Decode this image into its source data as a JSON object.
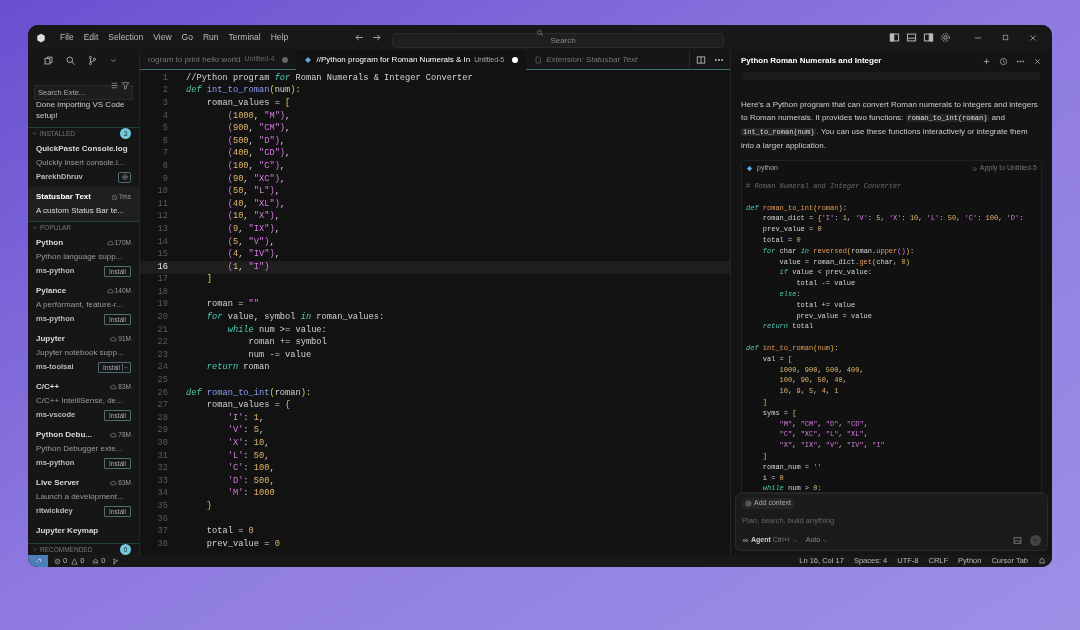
{
  "title_bar": {
    "menu": [
      "File",
      "Edit",
      "Selection",
      "View",
      "Go",
      "Run",
      "Terminal",
      "Help"
    ],
    "search": {
      "placeholder": "Search"
    }
  },
  "sidebar": {
    "search": {
      "placeholder": "Search Exte..."
    },
    "notice": "Done importing VS Code setup!",
    "sections": [
      {
        "title": "INSTALLED",
        "count": "3",
        "expanded": true,
        "items": [
          {
            "name": "QuickPaste Console.log",
            "description": "Quickly insert console.l...",
            "publisher": "ParekhDhruv",
            "kind": "gear",
            "selected": false
          },
          {
            "name": "Statusbar Text",
            "stat": {
              "kind": "time",
              "text": "7ms"
            },
            "description": "A custom Status Bar te...",
            "kind": "none",
            "selected": true
          }
        ]
      },
      {
        "title": "POPULAR",
        "expanded": true,
        "items": [
          {
            "name": "Python",
            "stat": {
              "kind": "downloads",
              "text": "170M"
            },
            "description": "Python language supp...",
            "publisher": "ms-python",
            "action": "Install",
            "kind": "install",
            "selected": false
          },
          {
            "name": "Pylance",
            "stat": {
              "kind": "downloads",
              "text": "140M"
            },
            "description": "A performant, feature-r...",
            "publisher": "ms-python",
            "action": "Install",
            "kind": "install",
            "selected": false
          },
          {
            "name": "Jupyter",
            "stat": {
              "kind": "downloads",
              "text": "91M"
            },
            "description": "Jupyter notebook supp...",
            "publisher": "ms-toolsai",
            "action": "Install",
            "kind": "split",
            "selected": false
          },
          {
            "name": "C/C++",
            "stat": {
              "kind": "downloads",
              "text": "83M"
            },
            "description": "C/C++ IntelliSense, de...",
            "publisher": "ms-vscode",
            "action": "Install",
            "kind": "install",
            "selected": false
          },
          {
            "name": "Python Debu...",
            "stat": {
              "kind": "downloads",
              "text": "78M"
            },
            "description": "Python Debugger exte...",
            "publisher": "ms-python",
            "action": "Install",
            "kind": "install",
            "selected": false
          },
          {
            "name": "Live Server",
            "stat": {
              "kind": "downloads",
              "text": "63M"
            },
            "description": "Launch a development...",
            "publisher": "ritwickdey",
            "action": "Install",
            "kind": "install",
            "selected": false
          },
          {
            "name": "Jupyter Keymap",
            "kind": "none",
            "selected": false
          }
        ]
      },
      {
        "title": "RECOMMENDED",
        "count": "0",
        "expanded": false
      }
    ]
  },
  "editor": {
    "tabs": [
      {
        "label": "rogram to print hello world",
        "description": "Untitled-4",
        "kind": "file",
        "selected": false,
        "modified": true
      },
      {
        "label": "//Python program for Roman Numerals & In",
        "description": "Untitled-5",
        "kind": "python",
        "selected": true,
        "modified": true
      },
      {
        "label": "Extension: Statusbar Text",
        "kind": "extension",
        "selected": false,
        "modified": false
      }
    ],
    "lines": [
      {
        "number": "1",
        "current": false,
        "tokens": [
          {
            "kind": "plain",
            "text": "//Python program "
          },
          {
            "kind": "kw",
            "text": "for"
          },
          {
            "kind": "plain",
            "text": " Roman Numerals & Integer Converter"
          }
        ]
      },
      {
        "number": "2",
        "current": false,
        "tokens": [
          {
            "kind": "kw",
            "text": "def "
          },
          {
            "kind": "fn",
            "text": "int_to_roman"
          },
          {
            "kind": "br",
            "text": "("
          },
          {
            "kind": "plain",
            "text": "num"
          },
          {
            "kind": "br",
            "text": ")"
          },
          {
            "kind": "plain",
            "text": ":"
          }
        ]
      },
      {
        "number": "3",
        "current": false,
        "tokens": [
          {
            "kind": "plain",
            "text": "    roman_values = "
          },
          {
            "kind": "br",
            "text": "["
          }
        ]
      },
      {
        "number": "4",
        "current": false,
        "tokens": [
          {
            "kind": "pr",
            "text": "        ("
          },
          {
            "kind": "num",
            "text": "1000"
          },
          {
            "kind": "plain",
            "text": ", "
          },
          {
            "kind": "str",
            "text": "\"M\""
          },
          {
            "kind": "pr",
            "text": ")"
          },
          {
            "kind": "plain",
            "text": ","
          }
        ]
      },
      {
        "number": "5",
        "current": false,
        "tokens": [
          {
            "kind": "pr",
            "text": "        ("
          },
          {
            "kind": "num",
            "text": "900"
          },
          {
            "kind": "plain",
            "text": ", "
          },
          {
            "kind": "str",
            "text": "\"CM\""
          },
          {
            "kind": "pr",
            "text": ")"
          },
          {
            "kind": "plain",
            "text": ","
          }
        ]
      },
      {
        "number": "6",
        "current": false,
        "tokens": [
          {
            "kind": "pr",
            "text": "        ("
          },
          {
            "kind": "num",
            "text": "500"
          },
          {
            "kind": "plain",
            "text": ", "
          },
          {
            "kind": "str",
            "text": "\"D\""
          },
          {
            "kind": "pr",
            "text": ")"
          },
          {
            "kind": "plain",
            "text": ","
          }
        ]
      },
      {
        "number": "7",
        "current": false,
        "tokens": [
          {
            "kind": "pr",
            "text": "        ("
          },
          {
            "kind": "num",
            "text": "400"
          },
          {
            "kind": "plain",
            "text": ", "
          },
          {
            "kind": "str",
            "text": "\"CD\""
          },
          {
            "kind": "pr",
            "text": ")"
          },
          {
            "kind": "plain",
            "text": ","
          }
        ]
      },
      {
        "number": "8",
        "current": false,
        "tokens": [
          {
            "kind": "pr",
            "text": "        ("
          },
          {
            "kind": "num",
            "text": "100"
          },
          {
            "kind": "plain",
            "text": ", "
          },
          {
            "kind": "str",
            "text": "\"C\""
          },
          {
            "kind": "pr",
            "text": ")"
          },
          {
            "kind": "plain",
            "text": ","
          }
        ]
      },
      {
        "number": "9",
        "current": false,
        "tokens": [
          {
            "kind": "pr",
            "text": "        ("
          },
          {
            "kind": "num",
            "text": "90"
          },
          {
            "kind": "plain",
            "text": ", "
          },
          {
            "kind": "str",
            "text": "\"XC\""
          },
          {
            "kind": "pr",
            "text": ")"
          },
          {
            "kind": "plain",
            "text": ","
          }
        ]
      },
      {
        "number": "10",
        "current": false,
        "tokens": [
          {
            "kind": "pr",
            "text": "        ("
          },
          {
            "kind": "num",
            "text": "50"
          },
          {
            "kind": "plain",
            "text": ", "
          },
          {
            "kind": "str",
            "text": "\"L\""
          },
          {
            "kind": "pr",
            "text": ")"
          },
          {
            "kind": "plain",
            "text": ","
          }
        ]
      },
      {
        "number": "11",
        "current": false,
        "tokens": [
          {
            "kind": "pr",
            "text": "        ("
          },
          {
            "kind": "num",
            "text": "40"
          },
          {
            "kind": "plain",
            "text": ", "
          },
          {
            "kind": "str",
            "text": "\"XL\""
          },
          {
            "kind": "pr",
            "text": ")"
          },
          {
            "kind": "plain",
            "text": ","
          }
        ]
      },
      {
        "number": "12",
        "current": false,
        "tokens": [
          {
            "kind": "pr",
            "text": "        ("
          },
          {
            "kind": "num",
            "text": "10"
          },
          {
            "kind": "plain",
            "text": ", "
          },
          {
            "kind": "str",
            "text": "\"X\""
          },
          {
            "kind": "pr",
            "text": ")"
          },
          {
            "kind": "plain",
            "text": ","
          }
        ]
      },
      {
        "number": "13",
        "current": false,
        "tokens": [
          {
            "kind": "pr",
            "text": "        ("
          },
          {
            "kind": "num",
            "text": "9"
          },
          {
            "kind": "plain",
            "text": ", "
          },
          {
            "kind": "str",
            "text": "\"IX\""
          },
          {
            "kind": "pr",
            "text": ")"
          },
          {
            "kind": "plain",
            "text": ","
          }
        ]
      },
      {
        "number": "14",
        "current": false,
        "tokens": [
          {
            "kind": "pr",
            "text": "        ("
          },
          {
            "kind": "num",
            "text": "5"
          },
          {
            "kind": "plain",
            "text": ", "
          },
          {
            "kind": "str",
            "text": "\"V\""
          },
          {
            "kind": "pr",
            "text": ")"
          },
          {
            "kind": "plain",
            "text": ","
          }
        ]
      },
      {
        "number": "15",
        "current": false,
        "tokens": [
          {
            "kind": "pr",
            "text": "        ("
          },
          {
            "kind": "num",
            "text": "4"
          },
          {
            "kind": "plain",
            "text": ", "
          },
          {
            "kind": "str",
            "text": "\"IV\""
          },
          {
            "kind": "pr",
            "text": ")"
          },
          {
            "kind": "plain",
            "text": ","
          }
        ]
      },
      {
        "number": "16",
        "current": true,
        "tokens": [
          {
            "kind": "pr",
            "text": "        ("
          },
          {
            "kind": "num",
            "text": "1"
          },
          {
            "kind": "plain",
            "text": ", "
          },
          {
            "kind": "str",
            "text": "\"I\""
          },
          {
            "kind": "pr",
            "text": ")"
          }
        ]
      },
      {
        "number": "17",
        "current": false,
        "tokens": [
          {
            "kind": "br",
            "text": "    ]"
          }
        ]
      },
      {
        "number": "18",
        "current": false
      },
      {
        "number": "19",
        "current": false,
        "tokens": [
          {
            "kind": "plain",
            "text": "    roman = "
          },
          {
            "kind": "str",
            "text": "\"\""
          }
        ]
      },
      {
        "number": "20",
        "current": false,
        "tokens": [
          {
            "kind": "kw",
            "text": "    for"
          },
          {
            "kind": "plain",
            "text": " value, symbol "
          },
          {
            "kind": "kw",
            "text": "in"
          },
          {
            "kind": "plain",
            "text": " roman_values:"
          }
        ]
      },
      {
        "number": "21",
        "current": false,
        "tokens": [
          {
            "kind": "kw",
            "text": "        while"
          },
          {
            "kind": "plain",
            "text": " num >= value:"
          }
        ]
      },
      {
        "number": "22",
        "current": false,
        "tokens": [
          {
            "kind": "plain",
            "text": "            roman += symbol"
          }
        ]
      },
      {
        "number": "23",
        "current": false,
        "tokens": [
          {
            "kind": "plain",
            "text": "            num -= value"
          }
        ]
      },
      {
        "number": "24",
        "current": false,
        "tokens": [
          {
            "kind": "kw",
            "text": "    return"
          },
          {
            "kind": "plain",
            "text": " roman"
          }
        ]
      },
      {
        "number": "25",
        "current": false
      },
      {
        "number": "26",
        "current": false,
        "tokens": [
          {
            "kind": "kw",
            "text": "def "
          },
          {
            "kind": "fn",
            "text": "roman_to_int"
          },
          {
            "kind": "br",
            "text": "("
          },
          {
            "kind": "plain",
            "text": "roman"
          },
          {
            "kind": "br",
            "text": ")"
          },
          {
            "kind": "plain",
            "text": ":"
          }
        ]
      },
      {
        "number": "27",
        "current": false,
        "tokens": [
          {
            "kind": "plain",
            "text": "    roman_values = "
          },
          {
            "kind": "br",
            "text": "{"
          }
        ]
      },
      {
        "number": "28",
        "current": false,
        "tokens": [
          {
            "kind": "str",
            "text": "        'I'"
          },
          {
            "kind": "plain",
            "text": ": "
          },
          {
            "kind": "num",
            "text": "1"
          },
          {
            "kind": "plain",
            "text": ","
          }
        ]
      },
      {
        "number": "29",
        "current": false,
        "tokens": [
          {
            "kind": "str",
            "text": "        'V'"
          },
          {
            "kind": "plain",
            "text": ": "
          },
          {
            "kind": "num",
            "text": "5"
          },
          {
            "kind": "plain",
            "text": ","
          }
        ]
      },
      {
        "number": "30",
        "current": false,
        "tokens": [
          {
            "kind": "str",
            "text": "        'X'"
          },
          {
            "kind": "plain",
            "text": ": "
          },
          {
            "kind": "num",
            "text": "10"
          },
          {
            "kind": "plain",
            "text": ","
          }
        ]
      },
      {
        "number": "31",
        "current": false,
        "tokens": [
          {
            "kind": "str",
            "text": "        'L'"
          },
          {
            "kind": "plain",
            "text": ": "
          },
          {
            "kind": "num",
            "text": "50"
          },
          {
            "kind": "plain",
            "text": ","
          }
        ]
      },
      {
        "number": "32",
        "current": false,
        "tokens": [
          {
            "kind": "str",
            "text": "        'C'"
          },
          {
            "kind": "plain",
            "text": ": "
          },
          {
            "kind": "num",
            "text": "100"
          },
          {
            "kind": "plain",
            "text": ","
          }
        ]
      },
      {
        "number": "33",
        "current": false,
        "tokens": [
          {
            "kind": "str",
            "text": "        'D'"
          },
          {
            "kind": "plain",
            "text": ": "
          },
          {
            "kind": "num",
            "text": "500"
          },
          {
            "kind": "plain",
            "text": ","
          }
        ]
      },
      {
        "number": "34",
        "current": false,
        "tokens": [
          {
            "kind": "str",
            "text": "        'M'"
          },
          {
            "kind": "plain",
            "text": ": "
          },
          {
            "kind": "num",
            "text": "1000"
          }
        ]
      },
      {
        "number": "35",
        "current": false,
        "tokens": [
          {
            "kind": "br",
            "text": "    }"
          }
        ]
      },
      {
        "number": "36",
        "current": false
      },
      {
        "number": "37",
        "current": false,
        "tokens": [
          {
            "kind": "plain",
            "text": "    total = "
          },
          {
            "kind": "num",
            "text": "0"
          }
        ]
      },
      {
        "number": "38",
        "current": false,
        "tokens": [
          {
            "kind": "plain",
            "text": "    prev_value = "
          },
          {
            "kind": "num",
            "text": "0"
          }
        ]
      }
    ]
  },
  "chat": {
    "title": "Python Roman Numerals and Integer",
    "response": [
      {
        "kind": "text",
        "text": "Here's a Python program that can convert Roman numerals to integers and integers to Roman numerals. It provides two functions: "
      },
      {
        "kind": "code",
        "text": "roman_to_int(roman)"
      },
      {
        "kind": "text",
        "text": " and "
      },
      {
        "kind": "code",
        "text": "int_to_roman(num)"
      },
      {
        "kind": "text",
        "text": ". You can use these functions interactively or integrate them into a larger application."
      }
    ],
    "code_block": {
      "language": "python",
      "action": "Apply to Untitled-5",
      "lines": [
        {
          "kind": "code",
          "tokens": [
            {
              "kind": "cm",
              "text": "# Roman Numeral and Integer Converter"
            }
          ]
        },
        {
          "kind": "blank"
        },
        {
          "kind": "code",
          "tokens": [
            {
              "kind": "kw",
              "text": "def "
            },
            {
              "kind": "fn",
              "text": "roman_to_int"
            },
            {
              "kind": "br",
              "text": "("
            },
            {
              "kind": "fn",
              "text": "roman"
            },
            {
              "kind": "br",
              "text": ")"
            },
            {
              "kind": "plain",
              "text": ":"
            }
          ]
        },
        {
          "kind": "code",
          "tokens": [
            {
              "kind": "plain",
              "text": "    roman_dict = "
            },
            {
              "kind": "br",
              "text": "{"
            },
            {
              "kind": "str",
              "text": "'I'"
            },
            {
              "kind": "plain",
              "text": ": "
            },
            {
              "kind": "num",
              "text": "1"
            },
            {
              "kind": "plain",
              "text": ", "
            },
            {
              "kind": "str",
              "text": "'V'"
            },
            {
              "kind": "plain",
              "text": ": "
            },
            {
              "kind": "num",
              "text": "5"
            },
            {
              "kind": "plain",
              "text": ", "
            },
            {
              "kind": "str",
              "text": "'X'"
            },
            {
              "kind": "plain",
              "text": ": "
            },
            {
              "kind": "num",
              "text": "10"
            },
            {
              "kind": "plain",
              "text": ", "
            },
            {
              "kind": "str",
              "text": "'L'"
            },
            {
              "kind": "plain",
              "text": ": "
            },
            {
              "kind": "num",
              "text": "50"
            },
            {
              "kind": "plain",
              "text": ", "
            },
            {
              "kind": "str",
              "text": "'C'"
            },
            {
              "kind": "plain",
              "text": ": "
            },
            {
              "kind": "num",
              "text": "100"
            },
            {
              "kind": "plain",
              "text": ", "
            },
            {
              "kind": "str",
              "text": "'D'"
            },
            {
              "kind": "plain",
              "text": ":"
            }
          ]
        },
        {
          "kind": "code",
          "tokens": [
            {
              "kind": "plain",
              "text": "    prev_value = "
            },
            {
              "kind": "num",
              "text": "0"
            }
          ]
        },
        {
          "kind": "code",
          "tokens": [
            {
              "kind": "plain",
              "text": "    total = "
            },
            {
              "kind": "num",
              "text": "0"
            }
          ]
        },
        {
          "kind": "code",
          "tokens": [
            {
              "kind": "kw",
              "text": "    for"
            },
            {
              "kind": "plain",
              "text": " char "
            },
            {
              "kind": "kw",
              "text": "in "
            },
            {
              "kind": "fn",
              "text": "reversed"
            },
            {
              "kind": "br",
              "text": "("
            },
            {
              "kind": "plain",
              "text": "roman."
            },
            {
              "kind": "fn",
              "text": "upper"
            },
            {
              "kind": "pr",
              "text": "()"
            },
            {
              "kind": "br",
              "text": ")"
            },
            {
              "kind": "plain",
              "text": ":"
            }
          ]
        },
        {
          "kind": "code",
          "tokens": [
            {
              "kind": "plain",
              "text": "        value = roman_dict."
            },
            {
              "kind": "fn",
              "text": "get"
            },
            {
              "kind": "br",
              "text": "("
            },
            {
              "kind": "plain",
              "text": "char, "
            },
            {
              "kind": "num",
              "text": "0"
            },
            {
              "kind": "br",
              "text": ")"
            }
          ]
        },
        {
          "kind": "code",
          "tokens": [
            {
              "kind": "kw",
              "text": "        if"
            },
            {
              "kind": "plain",
              "text": " value < prev_value:"
            }
          ]
        },
        {
          "kind": "code",
          "tokens": [
            {
              "kind": "plain",
              "text": "            total -= value"
            }
          ]
        },
        {
          "kind": "code",
          "tokens": [
            {
              "kind": "kw",
              "text": "        else"
            },
            {
              "kind": "plain",
              "text": ":"
            }
          ]
        },
        {
          "kind": "code",
          "tokens": [
            {
              "kind": "plain",
              "text": "            total += value"
            }
          ]
        },
        {
          "kind": "code",
          "tokens": [
            {
              "kind": "plain",
              "text": "            prev_value = value"
            }
          ]
        },
        {
          "kind": "code",
          "tokens": [
            {
              "kind": "kw",
              "text": "    return"
            },
            {
              "kind": "plain",
              "text": " total"
            }
          ]
        },
        {
          "kind": "blank"
        },
        {
          "kind": "code",
          "tokens": [
            {
              "kind": "kw",
              "text": "def "
            },
            {
              "kind": "fn",
              "text": "int_to_roman"
            },
            {
              "kind": "br",
              "text": "("
            },
            {
              "kind": "fn",
              "text": "num"
            },
            {
              "kind": "br",
              "text": ")"
            },
            {
              "kind": "plain",
              "text": ":"
            }
          ]
        },
        {
          "kind": "code",
          "tokens": [
            {
              "kind": "plain",
              "text": "    val = "
            },
            {
              "kind": "br",
              "text": "["
            }
          ]
        },
        {
          "kind": "code",
          "tokens": [
            {
              "kind": "num",
              "text": "        1000"
            },
            {
              "kind": "plain",
              "text": ", "
            },
            {
              "kind": "num",
              "text": "900"
            },
            {
              "kind": "plain",
              "text": ", "
            },
            {
              "kind": "num",
              "text": "500"
            },
            {
              "kind": "plain",
              "text": ", "
            },
            {
              "kind": "num",
              "text": "400"
            },
            {
              "kind": "plain",
              "text": ","
            }
          ]
        },
        {
          "kind": "code",
          "tokens": [
            {
              "kind": "num",
              "text": "        100"
            },
            {
              "kind": "plain",
              "text": ", "
            },
            {
              "kind": "num",
              "text": "90"
            },
            {
              "kind": "plain",
              "text": ", "
            },
            {
              "kind": "num",
              "text": "50"
            },
            {
              "kind": "plain",
              "text": ", "
            },
            {
              "kind": "num",
              "text": "40"
            },
            {
              "kind": "plain",
              "text": ","
            }
          ]
        },
        {
          "kind": "code",
          "tokens": [
            {
              "kind": "num",
              "text": "        10"
            },
            {
              "kind": "plain",
              "text": ", "
            },
            {
              "kind": "num",
              "text": "9"
            },
            {
              "kind": "plain",
              "text": ", "
            },
            {
              "kind": "num",
              "text": "5"
            },
            {
              "kind": "plain",
              "text": ", "
            },
            {
              "kind": "num",
              "text": "4"
            },
            {
              "kind": "plain",
              "text": ", "
            },
            {
              "kind": "num",
              "text": "1"
            }
          ]
        },
        {
          "kind": "code",
          "tokens": [
            {
              "kind": "br",
              "text": "    ]"
            }
          ]
        },
        {
          "kind": "code",
          "tokens": [
            {
              "kind": "plain",
              "text": "    syms = "
            },
            {
              "kind": "br",
              "text": "["
            }
          ]
        },
        {
          "kind": "code",
          "tokens": [
            {
              "kind": "str",
              "text": "        \"M\""
            },
            {
              "kind": "plain",
              "text": ", "
            },
            {
              "kind": "str",
              "text": "\"CM\""
            },
            {
              "kind": "plain",
              "text": ", "
            },
            {
              "kind": "str",
              "text": "\"D\""
            },
            {
              "kind": "plain",
              "text": ", "
            },
            {
              "kind": "str",
              "text": "\"CD\""
            },
            {
              "kind": "plain",
              "text": ","
            }
          ]
        },
        {
          "kind": "code",
          "tokens": [
            {
              "kind": "str",
              "text": "        \"C\""
            },
            {
              "kind": "plain",
              "text": ", "
            },
            {
              "kind": "str",
              "text": "\"XC\""
            },
            {
              "kind": "plain",
              "text": ", "
            },
            {
              "kind": "str",
              "text": "\"L\""
            },
            {
              "kind": "plain",
              "text": ", "
            },
            {
              "kind": "str",
              "text": "\"XL\""
            },
            {
              "kind": "plain",
              "text": ","
            }
          ]
        },
        {
          "kind": "code",
          "tokens": [
            {
              "kind": "str",
              "text": "        \"X\""
            },
            {
              "kind": "plain",
              "text": ", "
            },
            {
              "kind": "str",
              "text": "\"IX\""
            },
            {
              "kind": "plain",
              "text": ", "
            },
            {
              "kind": "str",
              "text": "\"V\""
            },
            {
              "kind": "plain",
              "text": ", "
            },
            {
              "kind": "str",
              "text": "\"IV\""
            },
            {
              "kind": "plain",
              "text": ", "
            },
            {
              "kind": "str",
              "text": "\"I\""
            }
          ]
        },
        {
          "kind": "code",
          "tokens": [
            {
              "kind": "br",
              "text": "    ]"
            }
          ]
        },
        {
          "kind": "code",
          "tokens": [
            {
              "kind": "plain",
              "text": "    roman_num = "
            },
            {
              "kind": "str",
              "text": "''"
            }
          ]
        },
        {
          "kind": "code",
          "tokens": [
            {
              "kind": "plain",
              "text": "    i = "
            },
            {
              "kind": "num",
              "text": "0"
            }
          ]
        },
        {
          "kind": "code",
          "tokens": [
            {
              "kind": "kw",
              "text": "    while"
            },
            {
              "kind": "plain",
              "text": " num > "
            },
            {
              "kind": "num",
              "text": "0"
            },
            {
              "kind": "plain",
              "text": ":"
            }
          ]
        }
      ]
    },
    "composer": {
      "context_button": "Add context",
      "placeholder": "Plan, search, build anything",
      "mode": "Agent",
      "shortcut": "Ctrl+I",
      "model": "Auto"
    }
  },
  "status_bar": {
    "errors": "0",
    "warnings": "0",
    "ports": "0",
    "right": [
      "Ln 16, Col 17",
      "Spaces: 4",
      "UTF-8",
      "CRLF",
      "Python",
      "Cursor Tab"
    ]
  }
}
